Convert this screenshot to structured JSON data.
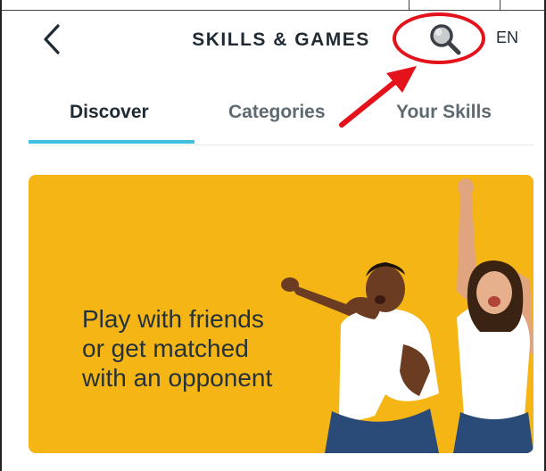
{
  "header": {
    "title": "SKILLS & GAMES",
    "back_icon": "chevron-left-icon",
    "search_icon": "magnifier-icon",
    "language": "EN",
    "highlight_color": "#e3121b"
  },
  "tabs": [
    {
      "label": "Discover",
      "active": true
    },
    {
      "label": "Categories",
      "active": false
    },
    {
      "label": "Your Skills",
      "active": false
    }
  ],
  "colors": {
    "accent": "#3ec0e0",
    "banner_bg": "#f5b515",
    "annotation": "#e3121b"
  },
  "banner": {
    "lines": [
      "Play with friends",
      "or get matched",
      "with an opponent"
    ]
  }
}
